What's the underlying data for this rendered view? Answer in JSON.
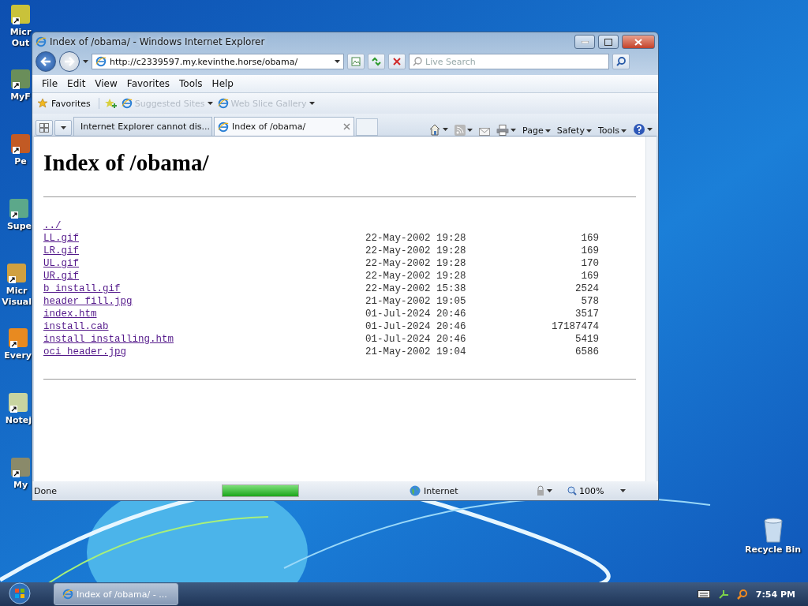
{
  "desktop_icons": [
    {
      "label": [
        "Micr",
        "Out"
      ]
    },
    {
      "label": [
        "MyF"
      ]
    },
    {
      "label": [
        "Pe"
      ]
    },
    {
      "label": [
        "Supe"
      ]
    },
    {
      "label": [
        "Micr",
        "Visual"
      ]
    },
    {
      "label": [
        "Every"
      ]
    },
    {
      "label": [
        "Notej"
      ]
    },
    {
      "label": [
        "My"
      ]
    }
  ],
  "recycle_bin": {
    "label": "Recycle Bin"
  },
  "window": {
    "title": "Index of /obama/ - Windows Internet Explorer",
    "address": "http://c2339597.my.kevinthe.horse/obama/",
    "search": {
      "placeholder": "Live Search"
    },
    "menu": [
      "File",
      "Edit",
      "View",
      "Favorites",
      "Tools",
      "Help"
    ],
    "favorites_bar": {
      "favorites": "Favorites",
      "links": [
        {
          "label": "Suggested Sites",
          "disabled": true
        },
        {
          "label": "Web Slice Gallery",
          "disabled": true
        }
      ]
    },
    "tabs": [
      {
        "label": "Internet Explorer cannot dis...",
        "selected": false
      },
      {
        "label": "Index of /obama/",
        "selected": true
      }
    ],
    "command_bar": [
      "Page",
      "Safety",
      "Tools"
    ],
    "page": {
      "heading": "Index of /obama/",
      "entries": [
        {
          "name": "../"
        },
        {
          "name": "LL.gif",
          "date": "22-May-2002 19:28",
          "size": "169"
        },
        {
          "name": "LR.gif",
          "date": "22-May-2002 19:28",
          "size": "169"
        },
        {
          "name": "UL.gif",
          "date": "22-May-2002 19:28",
          "size": "170"
        },
        {
          "name": "UR.gif",
          "date": "22-May-2002 19:28",
          "size": "169"
        },
        {
          "name": "b_install.gif",
          "date": "22-May-2002 15:38",
          "size": "2524"
        },
        {
          "name": "header_fill.jpg",
          "date": "21-May-2002 19:05",
          "size": "578"
        },
        {
          "name": "index.htm",
          "date": "01-Jul-2024 20:46",
          "size": "3517"
        },
        {
          "name": "install.cab",
          "date": "01-Jul-2024 20:46",
          "size": "17187474"
        },
        {
          "name": "install_installing.htm",
          "date": "01-Jul-2024 20:46",
          "size": "5419"
        },
        {
          "name": "oci_header.jpg",
          "date": "21-May-2002 19:04",
          "size": "6586"
        }
      ]
    },
    "status": {
      "text": "Done",
      "progress": {
        "level": 1
      },
      "zone": "Internet",
      "zoom": "100%"
    }
  },
  "taskbar": {
    "button": "Index of /obama/ - ...",
    "clock": "7:54 PM"
  }
}
